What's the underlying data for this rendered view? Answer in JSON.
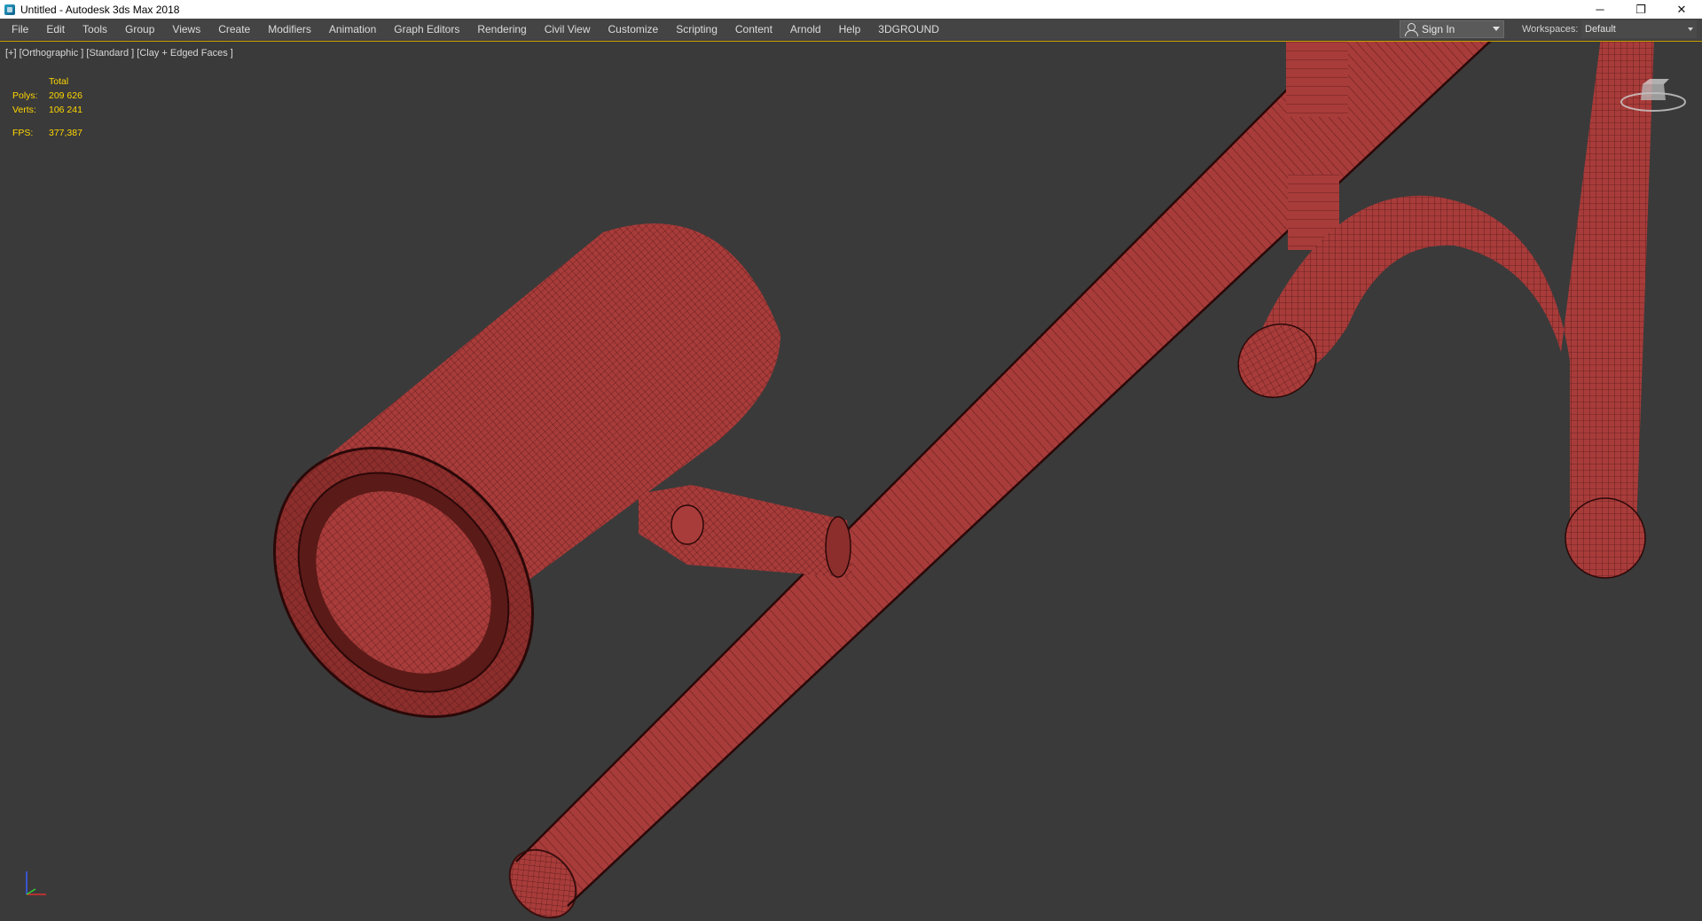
{
  "window": {
    "title": "Untitled - Autodesk 3ds Max 2018",
    "controls": {
      "minimize": "─",
      "restore": "❐",
      "close": "✕"
    }
  },
  "menubar": {
    "items": [
      "File",
      "Edit",
      "Tools",
      "Group",
      "Views",
      "Create",
      "Modifiers",
      "Animation",
      "Graph Editors",
      "Rendering",
      "Civil View",
      "Customize",
      "Scripting",
      "Content",
      "Arnold",
      "Help",
      "3DGROUND"
    ],
    "sign_in": "Sign In",
    "workspaces_label": "Workspaces:",
    "workspace_value": "Default"
  },
  "viewport": {
    "label": "[+] [Orthographic ] [Standard ] [Clay + Edged Faces ]",
    "stats": {
      "header": "Total",
      "polys_label": "Polys:",
      "polys_value": "209 626",
      "verts_label": "Verts:",
      "verts_value": "106 241",
      "fps_label": "FPS:",
      "fps_value": "377,387"
    },
    "colors": {
      "background": "#3a3a3a",
      "mesh": "#a83c3a",
      "wire": "#3a0e0e",
      "stats_text": "#ffd700",
      "active_border": "#c8a200"
    }
  }
}
